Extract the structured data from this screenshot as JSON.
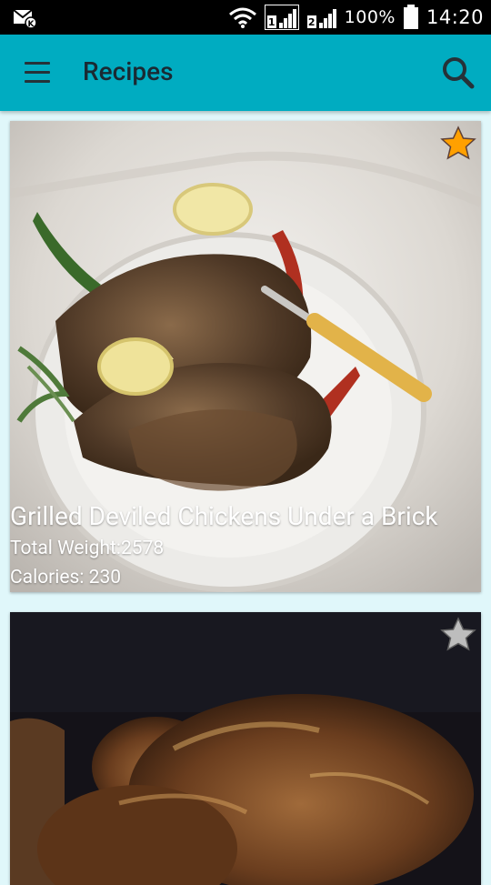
{
  "status_bar": {
    "sim1": "1",
    "sim2": "2",
    "battery": "100%",
    "time": "14:20"
  },
  "app_bar": {
    "title": "Recipes",
    "menu_icon": "hamburger-menu-icon",
    "search_icon": "search-icon",
    "color": "#00acc1"
  },
  "recipes": [
    {
      "title": "Grilled Deviled Chickens Under a Brick",
      "weight": "Total Weight:2578",
      "calories": "Calories: 230",
      "favorite": true
    },
    {
      "favorite": false
    }
  ],
  "colors": {
    "background": "#e0f7fa",
    "star_active": "#ffa000",
    "star_inactive": "#bdbdbd"
  }
}
